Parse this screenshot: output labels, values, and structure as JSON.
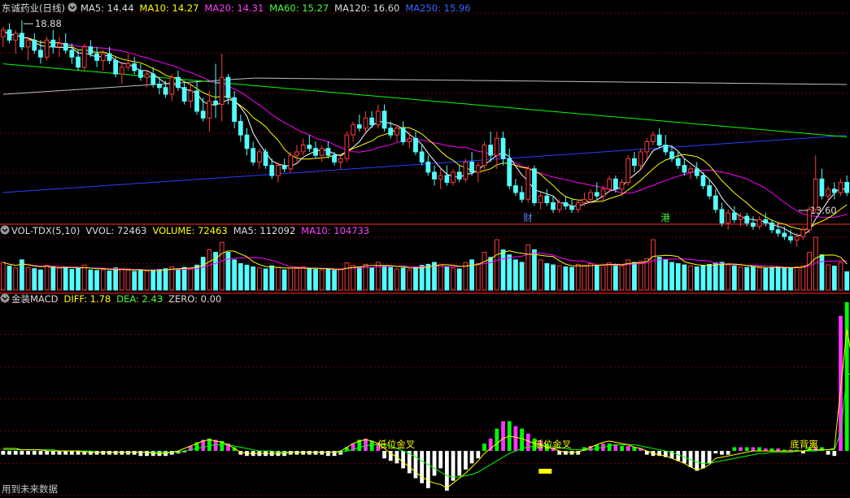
{
  "colors": {
    "bg": "#000000",
    "up": "#ff3c3c",
    "down": "#54ffff",
    "grid": "#7a0000",
    "divider": "#b01818",
    "ma5": "#ffffff",
    "ma10": "#ffff00",
    "ma20": "#ff00ff",
    "ma60": "#00ff00",
    "ma120": "#c0c0c0",
    "ma250": "#2d3cff",
    "label_white": "#dcdcdc",
    "label_yellow": "#ffff00",
    "label_magenta": "#ff40ff",
    "label_green": "#44ff44",
    "label_blue": "#3c64ff",
    "macd_pos": "#ff33ff",
    "macd_pos2": "#00ff00",
    "macd_neg": "#ffffff"
  },
  "price_panel": {
    "stock_name": "东诚药业(日线)",
    "indicators": [
      {
        "label": "MA5: 14.44",
        "color": "#dcdcdc"
      },
      {
        "label": "MA10: 14.27",
        "color": "#ffff00"
      },
      {
        "label": "MA20: 14.31",
        "color": "#ff40ff"
      },
      {
        "label": "MA60: 15.27",
        "color": "#44ff44"
      },
      {
        "label": "MA120: 16.60",
        "color": "#dcdcdc"
      },
      {
        "label": "MA250: 15.96",
        "color": "#3c64ff"
      }
    ],
    "high_marker": "18.88",
    "low_marker": "13.60",
    "event_marks": [
      {
        "text": "财",
        "bar": 84
      },
      {
        "text": "港",
        "bar": 106
      }
    ]
  },
  "volume_panel": {
    "indicators": [
      {
        "label": "VOL-TDX(5,10)",
        "color": "#dcdcdc"
      },
      {
        "label": "VVOL: 72463",
        "color": "#dcdcdc"
      },
      {
        "label": "VOLUME: 72463",
        "color": "#ffff00"
      },
      {
        "label": "MA5: 112092",
        "color": "#dcdcdc"
      },
      {
        "label": "MA10: 104733",
        "color": "#ff40ff"
      }
    ]
  },
  "macd_panel": {
    "indicators": [
      {
        "label": "金装MACD",
        "color": "#dcdcdc"
      },
      {
        "label": "DIFF: 1.78",
        "color": "#ffff00"
      },
      {
        "label": "DEA: 2.43",
        "color": "#44ff44"
      },
      {
        "label": "ZERO: 0.00",
        "color": "#dcdcdc"
      }
    ],
    "annotations": [
      {
        "text": "低位金叉",
        "bar": 87
      },
      {
        "text": "低位金叉",
        "bar": 62
      },
      {
        "text": "底背离",
        "bar": 128
      }
    ],
    "footer_note": "用到未来数据"
  },
  "chart_data": {
    "type": "candlestick",
    "price_range": [
      13.2,
      19.1
    ],
    "volume_max": 210000,
    "macd_range": [
      -3.6,
      12.0
    ],
    "bars": [
      [
        18.4,
        18.7,
        18.1,
        18.6,
        110000
      ],
      [
        18.6,
        18.8,
        18.2,
        18.3,
        95000
      ],
      [
        18.3,
        18.6,
        17.9,
        18.5,
        88000
      ],
      [
        18.5,
        18.88,
        18.0,
        18.1,
        120000
      ],
      [
        18.1,
        18.4,
        17.7,
        18.3,
        90000
      ],
      [
        18.3,
        18.5,
        17.9,
        18.0,
        85000
      ],
      [
        18.0,
        18.3,
        17.6,
        17.8,
        80000
      ],
      [
        17.8,
        18.4,
        17.7,
        18.3,
        98000
      ],
      [
        18.3,
        18.6,
        17.9,
        18.1,
        92000
      ],
      [
        18.1,
        18.4,
        17.8,
        18.2,
        87000
      ],
      [
        18.2,
        18.5,
        17.9,
        18.0,
        90000
      ],
      [
        18.0,
        18.2,
        17.6,
        17.8,
        82000
      ],
      [
        17.8,
        18.0,
        17.4,
        17.5,
        86000
      ],
      [
        17.5,
        18.2,
        17.4,
        18.1,
        99000
      ],
      [
        18.1,
        18.3,
        17.8,
        17.9,
        80000
      ],
      [
        17.9,
        18.1,
        17.5,
        17.7,
        78000
      ],
      [
        17.7,
        18.0,
        17.4,
        17.9,
        81000
      ],
      [
        17.9,
        18.1,
        17.6,
        17.7,
        76000
      ],
      [
        17.7,
        17.8,
        17.2,
        17.3,
        88000
      ],
      [
        17.3,
        17.6,
        17.0,
        17.5,
        84000
      ],
      [
        17.5,
        17.9,
        17.4,
        17.6,
        79000
      ],
      [
        17.6,
        17.8,
        17.3,
        17.4,
        74000
      ],
      [
        17.4,
        17.6,
        17.1,
        17.2,
        78000
      ],
      [
        17.2,
        17.4,
        16.9,
        17.3,
        76000
      ],
      [
        17.3,
        17.5,
        16.9,
        17.0,
        80000
      ],
      [
        17.0,
        17.2,
        16.7,
        16.9,
        82000
      ],
      [
        16.9,
        17.1,
        16.6,
        16.7,
        85000
      ],
      [
        16.7,
        17.3,
        16.5,
        17.2,
        92000
      ],
      [
        17.2,
        17.4,
        16.8,
        16.9,
        84000
      ],
      [
        16.9,
        17.1,
        16.4,
        16.5,
        90000
      ],
      [
        16.5,
        17.0,
        16.3,
        16.8,
        86000
      ],
      [
        16.8,
        17.1,
        16.1,
        16.2,
        99000
      ],
      [
        16.2,
        16.6,
        15.9,
        16.0,
        130000
      ],
      [
        16.0,
        16.8,
        15.6,
        16.5,
        160000
      ],
      [
        16.5,
        17.6,
        16.0,
        16.4,
        150000
      ],
      [
        16.4,
        17.9,
        15.9,
        17.2,
        190000
      ],
      [
        17.2,
        17.3,
        16.4,
        16.6,
        150000
      ],
      [
        16.6,
        16.8,
        15.7,
        15.9,
        120000
      ],
      [
        15.9,
        16.1,
        15.3,
        15.5,
        105000
      ],
      [
        15.5,
        15.7,
        14.9,
        15.1,
        99000
      ],
      [
        15.1,
        15.3,
        14.6,
        14.7,
        92000
      ],
      [
        14.7,
        15.1,
        14.5,
        15.0,
        88000
      ],
      [
        15.0,
        15.1,
        14.5,
        14.6,
        84000
      ],
      [
        14.6,
        14.8,
        14.2,
        14.3,
        96000
      ],
      [
        14.3,
        14.7,
        14.1,
        14.6,
        90000
      ],
      [
        14.6,
        14.8,
        14.4,
        14.5,
        80000
      ],
      [
        14.5,
        15.0,
        14.4,
        14.9,
        88000
      ],
      [
        14.9,
        15.2,
        14.7,
        15.0,
        86000
      ],
      [
        15.0,
        15.4,
        14.9,
        15.2,
        92000
      ],
      [
        15.2,
        15.5,
        15.0,
        15.1,
        87000
      ],
      [
        15.1,
        15.3,
        14.8,
        14.9,
        82000
      ],
      [
        14.9,
        15.2,
        14.7,
        15.1,
        80000
      ],
      [
        15.1,
        15.3,
        14.8,
        14.9,
        84000
      ],
      [
        14.9,
        15.0,
        14.6,
        14.7,
        78000
      ],
      [
        14.7,
        14.9,
        14.5,
        14.8,
        82000
      ],
      [
        14.8,
        15.6,
        14.7,
        15.5,
        108000
      ],
      [
        15.5,
        15.9,
        15.3,
        15.8,
        98000
      ],
      [
        15.8,
        16.1,
        15.6,
        15.7,
        92000
      ],
      [
        15.7,
        16.2,
        15.6,
        16.0,
        102000
      ],
      [
        16.0,
        16.2,
        15.7,
        15.8,
        88000
      ],
      [
        15.8,
        16.4,
        15.7,
        16.2,
        110000
      ],
      [
        16.2,
        16.4,
        15.6,
        15.7,
        96000
      ],
      [
        15.7,
        15.9,
        15.4,
        15.5,
        90000
      ],
      [
        15.5,
        15.8,
        15.3,
        15.7,
        84000
      ],
      [
        15.7,
        15.9,
        15.2,
        15.3,
        88000
      ],
      [
        15.3,
        15.6,
        15.1,
        15.4,
        80000
      ],
      [
        15.4,
        15.6,
        14.9,
        15.0,
        92000
      ],
      [
        15.0,
        15.2,
        14.6,
        14.7,
        98000
      ],
      [
        14.7,
        14.9,
        14.3,
        14.4,
        102000
      ],
      [
        14.4,
        14.6,
        14.0,
        14.2,
        110000
      ],
      [
        14.2,
        14.5,
        13.9,
        14.3,
        100000
      ],
      [
        14.3,
        14.6,
        14.0,
        14.1,
        92000
      ],
      [
        14.1,
        14.5,
        14.0,
        14.4,
        88000
      ],
      [
        14.4,
        14.6,
        14.1,
        14.2,
        84000
      ],
      [
        14.2,
        14.8,
        14.1,
        14.7,
        110000
      ],
      [
        14.7,
        15.0,
        14.3,
        14.4,
        120000
      ],
      [
        14.4,
        14.7,
        14.1,
        14.6,
        105000
      ],
      [
        14.6,
        15.3,
        14.5,
        15.2,
        150000
      ],
      [
        15.2,
        15.6,
        14.7,
        14.9,
        130000
      ],
      [
        14.9,
        15.6,
        14.5,
        15.4,
        200000
      ],
      [
        15.4,
        15.6,
        14.6,
        14.8,
        160000
      ],
      [
        14.8,
        15.1,
        13.9,
        14.0,
        140000
      ],
      [
        14.0,
        14.2,
        13.7,
        13.8,
        120000
      ],
      [
        13.8,
        14.0,
        13.5,
        13.6,
        110000
      ],
      [
        13.6,
        14.6,
        13.5,
        14.5,
        180000
      ],
      [
        14.5,
        14.6,
        13.4,
        13.5,
        160000
      ],
      [
        13.5,
        13.8,
        13.3,
        13.7,
        120000
      ],
      [
        13.7,
        13.9,
        13.4,
        13.5,
        105000
      ],
      [
        13.5,
        13.7,
        13.2,
        13.3,
        100000
      ],
      [
        13.3,
        13.6,
        13.2,
        13.5,
        96000
      ],
      [
        13.5,
        13.7,
        13.3,
        13.4,
        92000
      ],
      [
        13.4,
        13.6,
        13.2,
        13.3,
        90000
      ],
      [
        13.3,
        13.6,
        13.2,
        13.5,
        102000
      ],
      [
        13.5,
        13.8,
        13.4,
        13.6,
        98000
      ],
      [
        13.6,
        13.9,
        13.5,
        13.8,
        105000
      ],
      [
        13.8,
        14.1,
        13.6,
        13.7,
        96000
      ],
      [
        13.7,
        14.0,
        13.5,
        13.9,
        100000
      ],
      [
        13.9,
        14.3,
        13.8,
        14.2,
        108000
      ],
      [
        14.2,
        14.3,
        13.8,
        13.9,
        102000
      ],
      [
        13.9,
        14.2,
        13.7,
        14.1,
        96000
      ],
      [
        14.1,
        14.9,
        14.0,
        14.8,
        120000
      ],
      [
        14.8,
        15.0,
        14.4,
        14.6,
        110000
      ],
      [
        14.6,
        15.1,
        14.5,
        15.0,
        115000
      ],
      [
        15.0,
        15.4,
        14.8,
        15.3,
        125000
      ],
      [
        15.3,
        15.6,
        15.2,
        15.5,
        200000
      ],
      [
        15.5,
        15.7,
        15.1,
        15.2,
        130000
      ],
      [
        15.2,
        15.5,
        14.9,
        15.0,
        120000
      ],
      [
        15.0,
        15.2,
        14.7,
        14.8,
        110000
      ],
      [
        14.8,
        15.0,
        14.5,
        14.6,
        105000
      ],
      [
        14.6,
        14.8,
        14.3,
        14.4,
        100000
      ],
      [
        14.4,
        14.6,
        14.2,
        14.5,
        96000
      ],
      [
        14.5,
        14.7,
        14.2,
        14.3,
        92000
      ],
      [
        14.3,
        14.4,
        13.9,
        14.0,
        98000
      ],
      [
        14.0,
        14.2,
        13.6,
        13.7,
        102000
      ],
      [
        13.7,
        13.9,
        13.2,
        13.3,
        108000
      ],
      [
        13.3,
        13.5,
        12.8,
        12.9,
        110000
      ],
      [
        12.9,
        13.3,
        12.7,
        13.2,
        100000
      ],
      [
        13.2,
        13.4,
        12.9,
        13.0,
        96000
      ],
      [
        13.0,
        13.2,
        12.8,
        13.1,
        92000
      ],
      [
        13.1,
        13.2,
        12.8,
        12.9,
        90000
      ],
      [
        12.9,
        13.1,
        12.7,
        12.8,
        92000
      ],
      [
        12.8,
        13.1,
        12.7,
        13.0,
        88000
      ],
      [
        13.0,
        13.2,
        12.8,
        12.9,
        86000
      ],
      [
        12.9,
        13.0,
        12.6,
        12.7,
        90000
      ],
      [
        12.7,
        12.9,
        12.5,
        12.6,
        92000
      ],
      [
        12.6,
        12.8,
        12.4,
        12.5,
        88000
      ],
      [
        12.5,
        12.7,
        12.3,
        12.4,
        86000
      ],
      [
        12.4,
        12.6,
        12.2,
        12.5,
        92000
      ],
      [
        12.5,
        12.8,
        12.4,
        12.7,
        96000
      ],
      [
        12.7,
        13.4,
        12.6,
        13.3,
        150000
      ],
      [
        13.3,
        14.9,
        13.2,
        14.2,
        210000
      ],
      [
        14.2,
        14.5,
        13.6,
        13.7,
        140000
      ],
      [
        13.7,
        14.0,
        13.5,
        13.9,
        100000
      ],
      [
        13.9,
        14.1,
        13.6,
        13.8,
        95000
      ],
      [
        13.8,
        14.2,
        13.7,
        14.1,
        110000
      ],
      [
        14.1,
        14.3,
        13.7,
        13.8,
        72463
      ]
    ],
    "macd_hist": [
      -0.3,
      -0.3,
      -0.3,
      -0.3,
      -0.3,
      -0.3,
      -0.3,
      -0.3,
      -0.3,
      -0.3,
      -0.3,
      -0.3,
      -0.3,
      -0.3,
      -0.3,
      -0.3,
      -0.3,
      -0.3,
      -0.3,
      -0.3,
      -0.3,
      -0.3,
      -0.4,
      -0.4,
      -0.4,
      -0.4,
      -0.4,
      -0.3,
      -0.2,
      -0.1,
      0.4,
      0.7,
      0.9,
      1.0,
      0.9,
      0.8,
      0.6,
      0.3,
      -0.3,
      -0.4,
      -0.4,
      -0.4,
      -0.4,
      -0.4,
      -0.4,
      -0.4,
      -0.3,
      -0.3,
      -0.3,
      -0.3,
      -0.3,
      -0.3,
      -0.4,
      -0.4,
      -0.3,
      0.3,
      0.6,
      0.9,
      1.0,
      0.8,
      0.6,
      -0.6,
      -0.8,
      -1.0,
      -1.4,
      -1.8,
      -2.2,
      -2.6,
      -3.0,
      -2.0,
      -1.4,
      -3.2,
      -2.4,
      -2.0,
      -1.5,
      -1.0,
      -0.6,
      0.6,
      1.0,
      1.8,
      2.4,
      2.4,
      2.0,
      1.8,
      1.4,
      1.0,
      0.8,
      0.6,
      0.3,
      -0.3,
      -0.3,
      -0.3,
      -0.3,
      0.3,
      0.4,
      0.5,
      0.6,
      0.6,
      0.5,
      0.4,
      0.4,
      0.3,
      0.2,
      -0.3,
      -0.4,
      -0.4,
      -0.5,
      -0.6,
      -0.8,
      -1.0,
      -1.3,
      -1.6,
      -1.4,
      -1.0,
      -0.2,
      -0.3,
      -0.3,
      0.3,
      0.3,
      0.3,
      0.3,
      0.3,
      0.2,
      0.2,
      0.2,
      0.1,
      0.1,
      0.1,
      -0.2,
      0.3,
      0.3,
      0.3,
      -0.3,
      -0.4,
      10.9,
      12.0,
      8.0,
      5.0,
      -3.3
    ],
    "macd_diff": [
      0.2,
      0.2,
      0.2,
      0.1,
      0.1,
      0.1,
      0.1,
      0.0,
      0.0,
      0.0,
      0.0,
      0.0,
      0.0,
      -0.1,
      -0.1,
      -0.1,
      -0.1,
      -0.1,
      -0.1,
      -0.1,
      -0.1,
      -0.1,
      -0.1,
      -0.1,
      -0.2,
      -0.2,
      -0.2,
      -0.1,
      0.0,
      0.2,
      0.4,
      0.6,
      0.8,
      0.9,
      0.8,
      0.7,
      0.5,
      0.2,
      -0.1,
      -0.2,
      -0.2,
      -0.2,
      -0.2,
      -0.2,
      -0.2,
      -0.2,
      -0.1,
      -0.1,
      -0.1,
      -0.1,
      -0.1,
      -0.1,
      -0.1,
      -0.1,
      0.0,
      0.3,
      0.6,
      0.8,
      0.9,
      0.8,
      0.6,
      0.2,
      -0.2,
      -0.5,
      -0.9,
      -1.3,
      -1.7,
      -2.1,
      -2.4,
      -2.6,
      -2.7,
      -3.0,
      -2.6,
      -2.2,
      -1.8,
      -1.3,
      -0.8,
      -0.2,
      0.2,
      0.6,
      1.0,
      1.2,
      1.1,
      1.0,
      0.8,
      0.6,
      0.5,
      0.3,
      0.2,
      0.0,
      -0.1,
      -0.1,
      -0.1,
      0.1,
      0.3,
      0.5,
      0.7,
      0.8,
      0.7,
      0.6,
      0.5,
      0.3,
      0.2,
      0.0,
      -0.2,
      -0.3,
      -0.4,
      -0.6,
      -0.8,
      -1.0,
      -1.3,
      -1.5,
      -1.4,
      -1.1,
      -0.6,
      -0.5,
      -0.4,
      -0.3,
      -0.2,
      -0.1,
      0.0,
      0.0,
      0.0,
      0.0,
      0.0,
      0.0,
      0.0,
      0.0,
      0.0,
      0.1,
      0.1,
      0.1,
      0.1,
      0.2,
      5.0,
      9.8,
      7.0,
      4.5,
      1.78
    ],
    "macd_dea": [
      0.1,
      0.1,
      0.1,
      0.1,
      0.1,
      0.1,
      0.1,
      0.1,
      0.1,
      0.0,
      0.0,
      0.0,
      0.0,
      0.0,
      0.0,
      -0.1,
      -0.1,
      -0.1,
      -0.1,
      -0.1,
      -0.1,
      -0.1,
      -0.1,
      -0.1,
      -0.1,
      -0.1,
      -0.1,
      -0.1,
      -0.1,
      0.0,
      0.1,
      0.2,
      0.3,
      0.4,
      0.5,
      0.5,
      0.5,
      0.4,
      0.3,
      0.2,
      0.1,
      0.0,
      0.0,
      0.0,
      -0.1,
      -0.1,
      -0.1,
      -0.1,
      -0.1,
      -0.1,
      -0.1,
      -0.1,
      -0.1,
      -0.1,
      -0.1,
      0.0,
      0.1,
      0.3,
      0.4,
      0.5,
      0.5,
      0.5,
      0.4,
      0.2,
      0.0,
      -0.2,
      -0.5,
      -0.8,
      -1.1,
      -1.4,
      -1.7,
      -2.0,
      -2.1,
      -2.1,
      -2.0,
      -1.9,
      -1.7,
      -1.4,
      -1.1,
      -0.8,
      -0.5,
      -0.2,
      0.0,
      0.2,
      0.3,
      0.4,
      0.4,
      0.4,
      0.4,
      0.3,
      0.2,
      0.1,
      0.1,
      0.1,
      0.1,
      0.2,
      0.3,
      0.4,
      0.5,
      0.5,
      0.5,
      0.5,
      0.4,
      0.3,
      0.2,
      0.1,
      0.0,
      -0.1,
      -0.3,
      -0.5,
      -0.7,
      -0.9,
      -1.0,
      -1.0,
      -0.9,
      -0.8,
      -0.7,
      -0.6,
      -0.5,
      -0.4,
      -0.3,
      -0.2,
      -0.2,
      -0.1,
      -0.1,
      -0.1,
      -0.1,
      0.0,
      0.0,
      0.0,
      0.0,
      0.1,
      0.1,
      0.1,
      1.5,
      6.0,
      6.5,
      5.6,
      2.43
    ]
  }
}
